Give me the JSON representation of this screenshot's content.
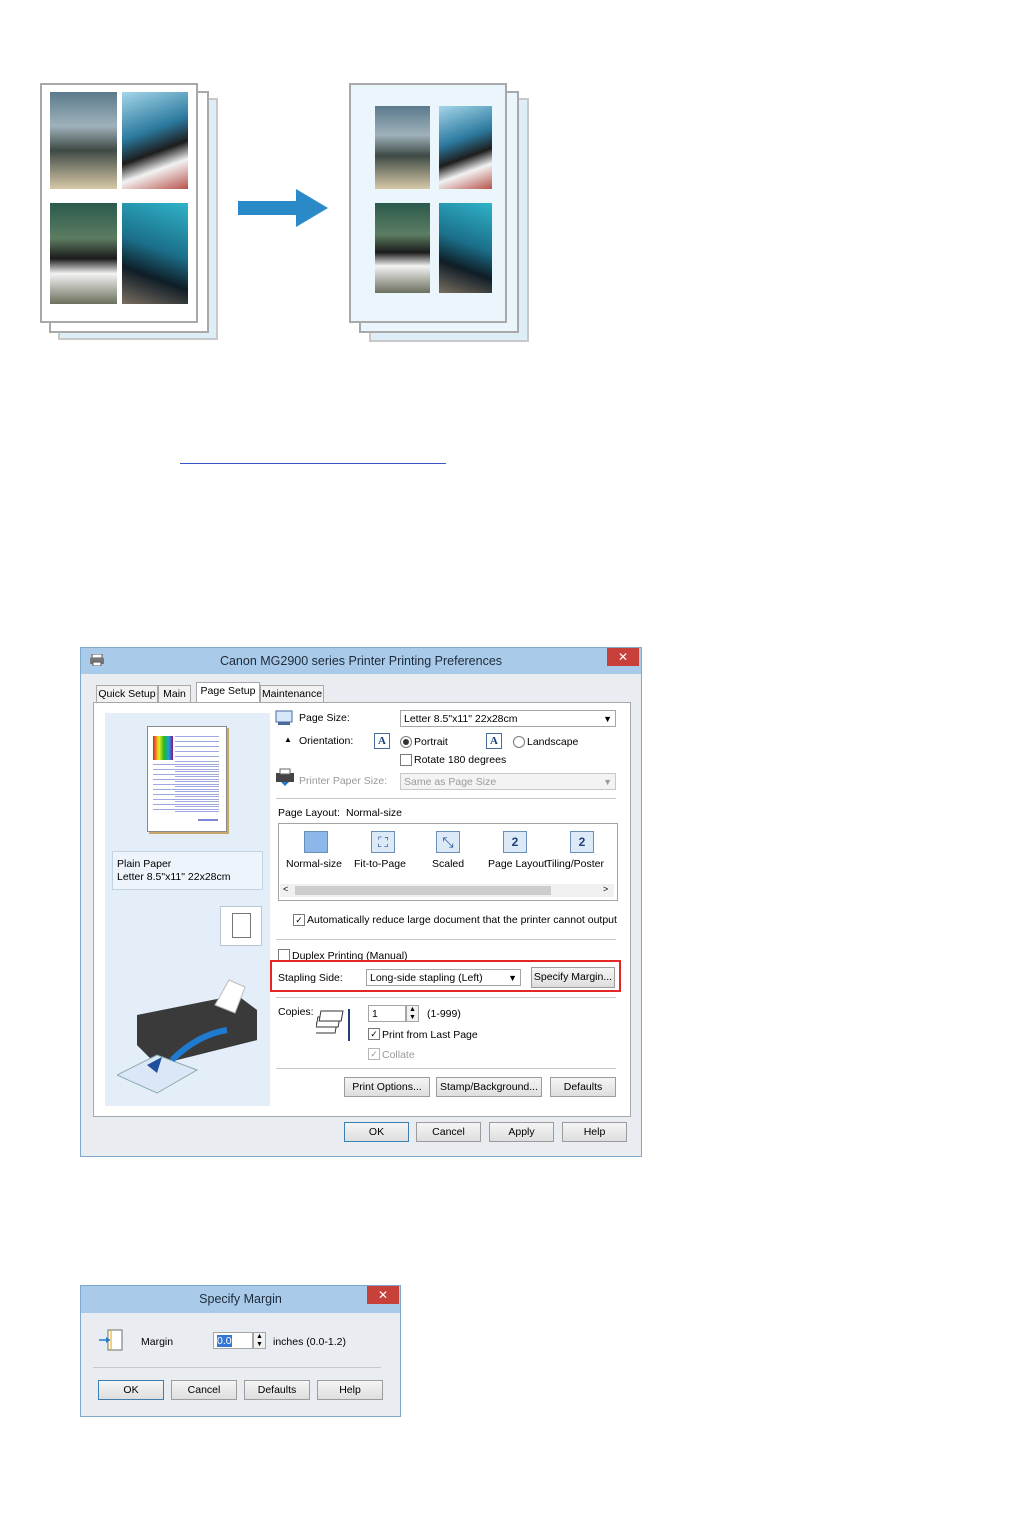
{
  "main_dialog": {
    "title": "Canon MG2900 series Printer Printing Preferences",
    "close_glyph": "✕",
    "tabs": [
      {
        "label": "Quick Setup",
        "active": false
      },
      {
        "label": "Main",
        "active": false
      },
      {
        "label": "Page Setup",
        "active": true
      },
      {
        "label": "Maintenance",
        "active": false
      }
    ],
    "preview": {
      "paper_type": "Plain Paper",
      "paper_size": "Letter 8.5\"x11\" 22x28cm"
    },
    "page_size": {
      "label": "Page Size:",
      "value": "Letter 8.5\"x11\" 22x28cm"
    },
    "orientation": {
      "label": "Orientation:",
      "icon_letter": "A",
      "portrait_label": "Portrait",
      "landscape_label": "Landscape",
      "selected": "portrait",
      "rotate_label": "Rotate 180 degrees",
      "rotate_checked": false
    },
    "printer_paper_size": {
      "label": "Printer Paper Size:",
      "value": "Same as Page Size",
      "disabled": true
    },
    "page_layout": {
      "label": "Page Layout:",
      "current": "Normal-size",
      "options": [
        "Normal-size",
        "Fit-to-Page",
        "Scaled",
        "Page Layout",
        "Tiling/Poster"
      ],
      "option_glyphs": [
        "",
        "⛶",
        "⤡",
        "2",
        "2"
      ]
    },
    "auto_reduce": {
      "label": "Automatically reduce large document that the printer cannot output",
      "checked": true
    },
    "duplex": {
      "label": "Duplex Printing (Manual)",
      "checked": false
    },
    "stapling_side": {
      "label": "Stapling Side:",
      "value": "Long-side stapling (Left)",
      "highlight_color": "#e32626"
    },
    "specify_margin_button": "Specify Margin...",
    "copies": {
      "label": "Copies:",
      "value": "1",
      "range": "(1-999)",
      "print_from_last_label": "Print from Last Page",
      "print_from_last_checked": true,
      "collate_label": "Collate",
      "collate_checked": true
    },
    "buttons_row": [
      "Print Options...",
      "Stamp/Background...",
      "Defaults"
    ],
    "footer_buttons": [
      "OK",
      "Cancel",
      "Apply",
      "Help"
    ]
  },
  "margin_dialog": {
    "title": "Specify Margin",
    "close_glyph": "✕",
    "margin_label": "Margin",
    "margin_value": "0.0",
    "unit_text": "inches (0.0-1.2)",
    "buttons": [
      "OK",
      "Cancel",
      "Defaults",
      "Help"
    ]
  },
  "colors": {
    "arrow": "#2a8ac7",
    "titlebar": "#a9cbe9",
    "close": "#c7413a",
    "link": "#3a55c8"
  }
}
